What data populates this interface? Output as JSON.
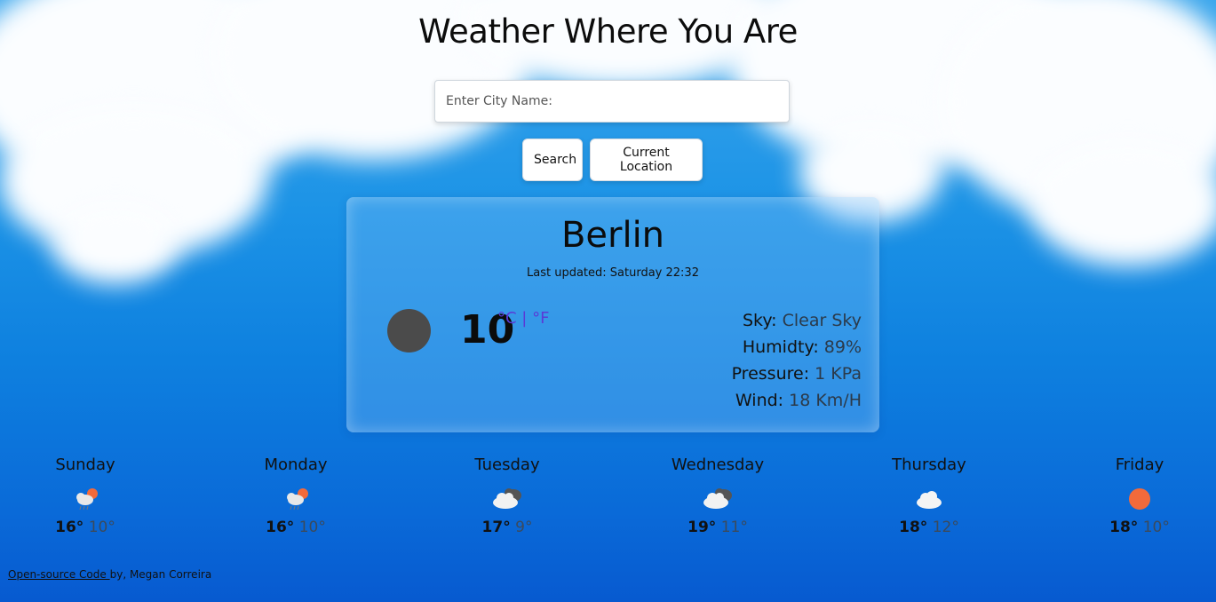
{
  "header": {
    "title": "Weather Where You Are"
  },
  "search": {
    "placeholder": "Enter City Name:",
    "search_label": "Search",
    "location_label": "Current Location"
  },
  "current": {
    "city": "Berlin",
    "updated": "Last updated: Saturday 22:32",
    "temperature": "10",
    "unit_c": "°C",
    "unit_sep": " | ",
    "unit_f": "°F",
    "icon": "night-clear-icon",
    "sky_label": "Sky:",
    "sky_value": "Clear Sky",
    "humidity_label": "Humidty:",
    "humidity_value": "89%",
    "pressure_label": "Pressure:",
    "pressure_value": "1 KPa",
    "wind_label": "Wind:",
    "wind_value": "18 Km/H"
  },
  "forecast": [
    {
      "day": "Sunday",
      "icon": "rain-sun-cloud-icon",
      "high": "16°",
      "low": "10°"
    },
    {
      "day": "Monday",
      "icon": "rain-sun-cloud-icon",
      "high": "16°",
      "low": "10°"
    },
    {
      "day": "Tuesday",
      "icon": "broken-clouds-icon",
      "high": "17°",
      "low": "9°"
    },
    {
      "day": "Wednesday",
      "icon": "broken-clouds-icon",
      "high": "19°",
      "low": "11°"
    },
    {
      "day": "Thursday",
      "icon": "cloud-icon",
      "high": "18°",
      "low": "12°"
    },
    {
      "day": "Friday",
      "icon": "sun-icon",
      "high": "18°",
      "low": "10°"
    }
  ],
  "footer": {
    "link_text": "Open-source Code ",
    "credit": "by, Megan Correira"
  },
  "colors": {
    "sun": "#f26a3b",
    "moon": "#4b4b4b",
    "unit_link": "#5a3ad6"
  }
}
